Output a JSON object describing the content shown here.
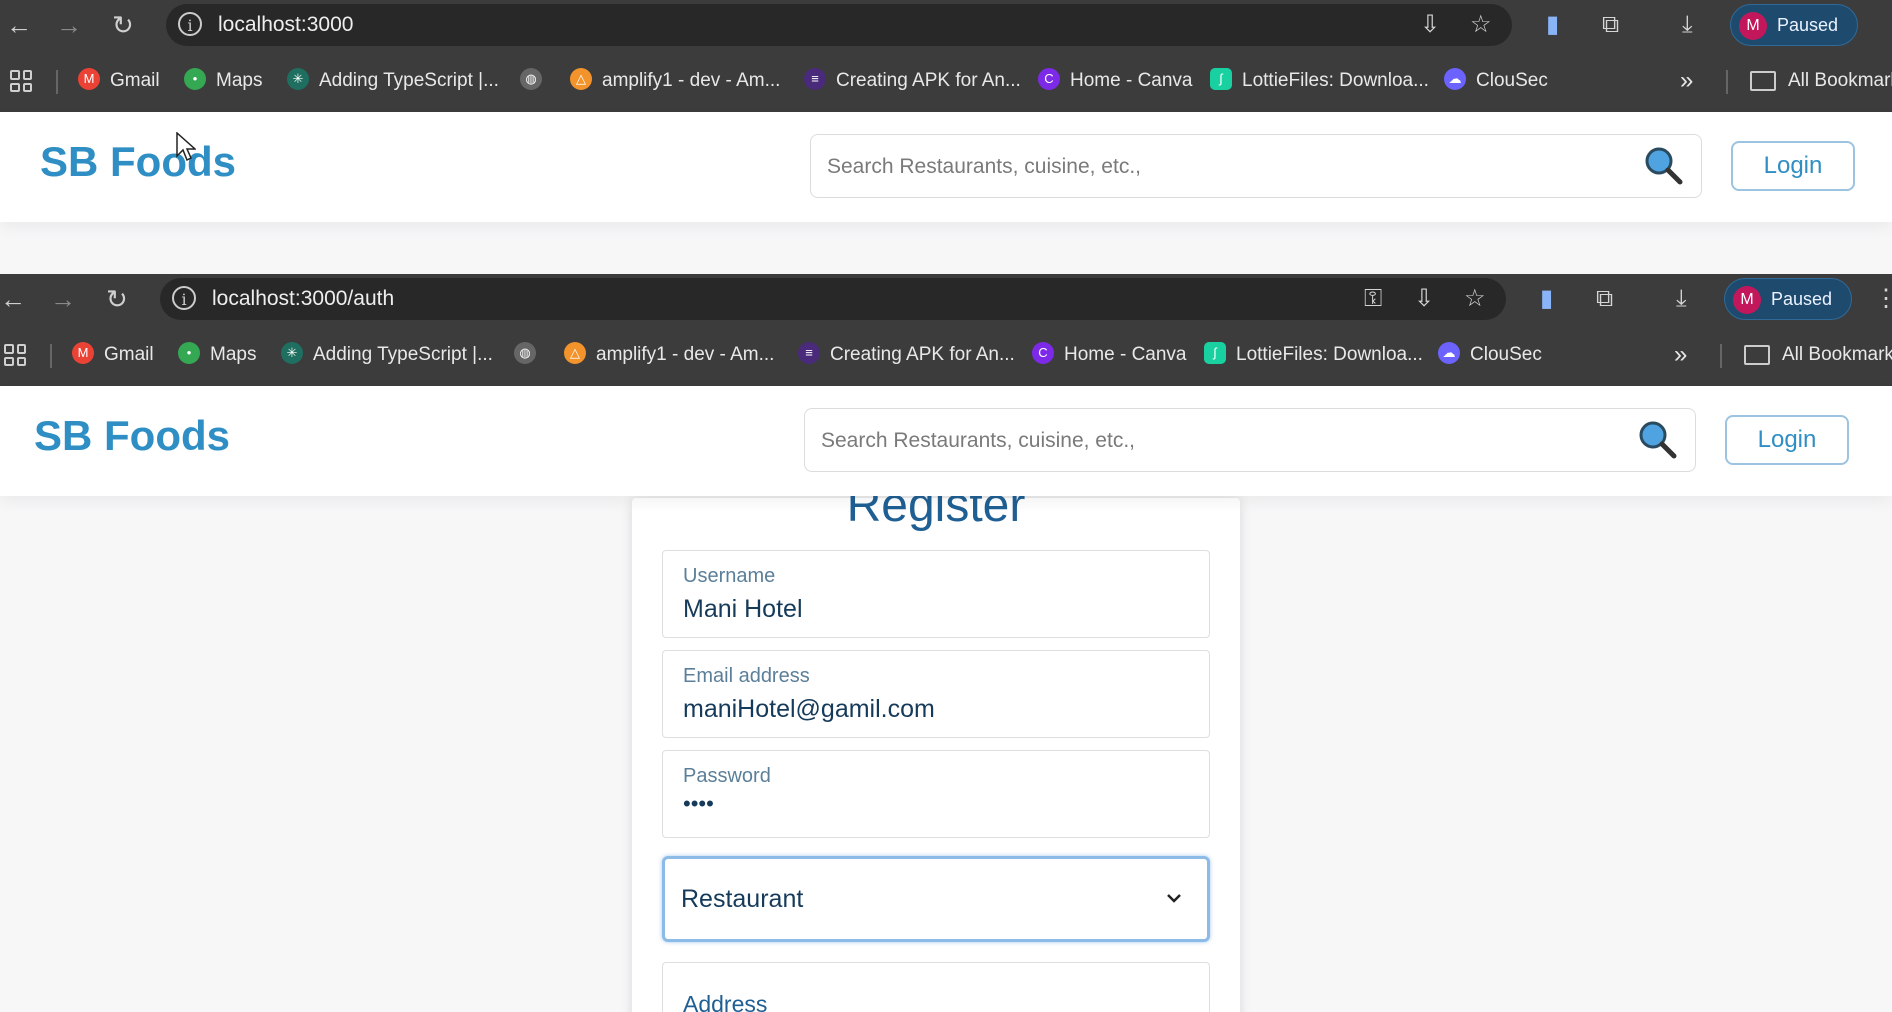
{
  "browser_top": {
    "url": "localhost:3000",
    "profile_initial": "M",
    "profile_status": "Paused"
  },
  "browser_bottom": {
    "url": "localhost:3000/auth",
    "profile_initial": "M",
    "profile_status": "Paused"
  },
  "bookmarks": [
    {
      "label": "Gmail",
      "icon": "gmail-icon",
      "color": "#ea4335"
    },
    {
      "label": "Maps",
      "icon": "maps-pin-icon",
      "color": "#34a853"
    },
    {
      "label": "Adding TypeScript |...",
      "icon": "react-icon",
      "color": "#26c6a6"
    },
    {
      "label": "",
      "icon": "globe-icon",
      "color": "#cccccc"
    },
    {
      "label": "amplify1 - dev - Am...",
      "icon": "amplify-icon",
      "color": "#f2932b"
    },
    {
      "label": "Creating APK for An...",
      "icon": "expo-icon",
      "color": "#4a2a7a"
    },
    {
      "label": "Home - Canva",
      "icon": "canva-icon",
      "color": "#7d2ae8"
    },
    {
      "label": "LottieFiles: Downloa...",
      "icon": "lottie-icon",
      "color": "#19d1a0"
    },
    {
      "label": "ClouSec",
      "icon": "clousec-icon",
      "color": "#6c63ff"
    }
  ],
  "all_bookmarks_label": "All Bookmarks",
  "site": {
    "brand": "SB Foods",
    "search_placeholder": "Search Restaurants, cuisine, etc.,",
    "login_label": "Login",
    "accent": "#2f8fc4"
  },
  "register": {
    "title": "Register",
    "username_label": "Username",
    "username_value": "Mani Hotel",
    "email_label": "Email address",
    "email_value": "maniHotel@gamil.com",
    "password_label": "Password",
    "password_value": "••••",
    "usertype_value": "Restaurant",
    "address_label": "Address"
  }
}
